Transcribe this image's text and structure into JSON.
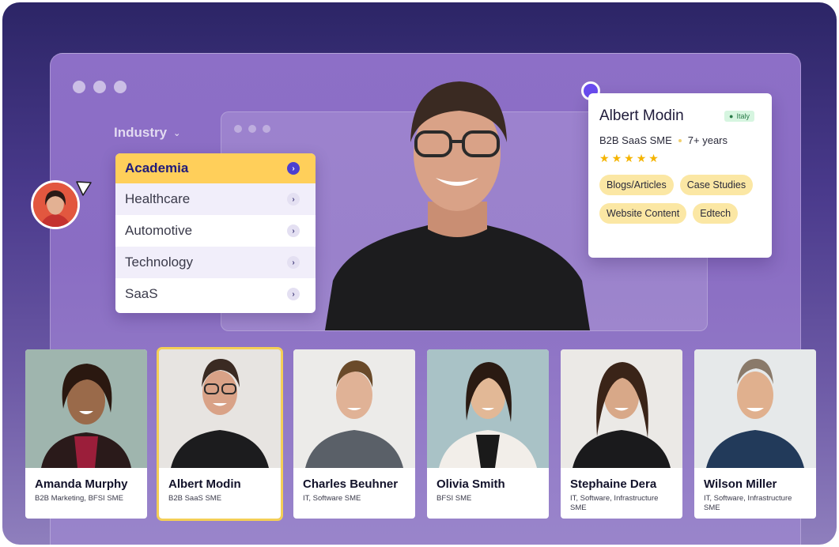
{
  "industry_filter": {
    "label": "Industry",
    "options": [
      {
        "label": "Academia",
        "active": true
      },
      {
        "label": "Healthcare",
        "active": false
      },
      {
        "label": "Automotive",
        "active": false
      },
      {
        "label": "Technology",
        "active": false
      },
      {
        "label": "SaaS",
        "active": false
      }
    ]
  },
  "profile": {
    "name": "Albert Modin",
    "location": "Italy",
    "specialty": "B2B SaaS SME",
    "experience": "7+ years",
    "rating": 5,
    "tags": [
      "Blogs/Articles",
      "Case Studies",
      "Website Content",
      "Edtech"
    ]
  },
  "experts": [
    {
      "name": "Amanda Murphy",
      "role": "B2B Marketing, BFSI SME",
      "selected": false
    },
    {
      "name": "Albert Modin",
      "role": "B2B SaaS SME",
      "selected": true
    },
    {
      "name": "Charles Beuhner",
      "role": "IT, Software SME",
      "selected": false
    },
    {
      "name": "Olivia Smith",
      "role": "BFSI SME",
      "selected": false
    },
    {
      "name": "Stephaine Dera",
      "role": "IT, Software, Infrastructure SME",
      "selected": false
    },
    {
      "name": "Wilson Miller",
      "role": "IT, Software, Infrastructure SME",
      "selected": false
    }
  ],
  "colors": {
    "accent_yellow": "#ffcf5a",
    "accent_purple": "#4b3fd0",
    "tag_bg": "#fbe7a4",
    "star": "#f5b400"
  },
  "icons": {
    "dropdown_arrow": "chevron-right-icon",
    "industry_chevron": "chevron-down-icon",
    "location": "map-pin-icon",
    "cursor": "cursor-pointer-icon"
  }
}
